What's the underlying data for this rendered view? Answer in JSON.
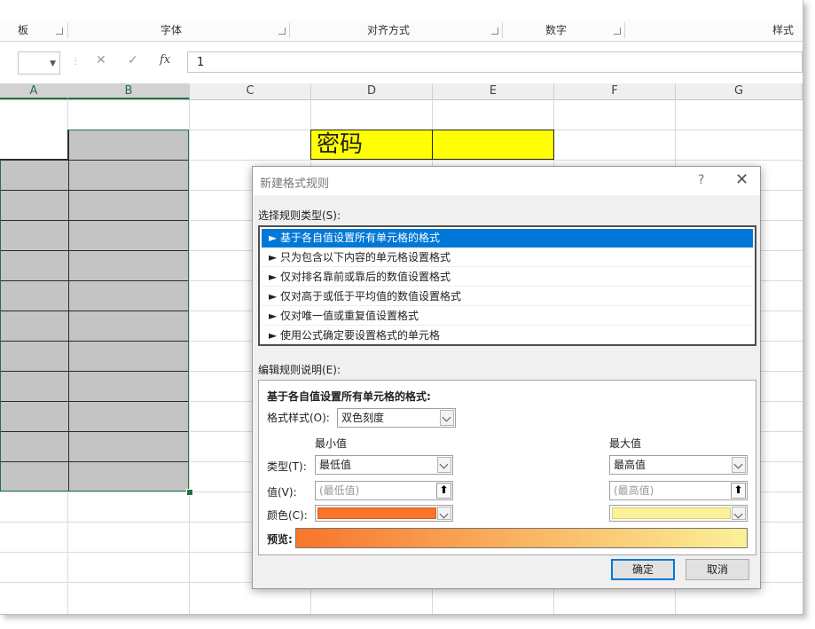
{
  "ribbon": {
    "groups": [
      "板",
      "字体",
      "对齐方式",
      "数字",
      "样式"
    ]
  },
  "formula_bar": {
    "name_box": "",
    "cancel": "✕",
    "enter": "✓",
    "fx": "fx",
    "value": "1"
  },
  "columns": [
    "A",
    "B",
    "C",
    "D",
    "E",
    "F",
    "G"
  ],
  "cells": {
    "D3": "密码"
  },
  "dialog": {
    "title": "新建格式规则",
    "help": "?",
    "close": "✕",
    "select_type_label": "选择规则类型(S):",
    "rule_types": [
      "► 基于各自值设置所有单元格的格式",
      "► 只为包含以下内容的单元格设置格式",
      "► 仅对排名靠前或靠后的数值设置格式",
      "► 仅对高于或低于平均值的数值设置格式",
      "► 仅对唯一值或重复值设置格式",
      "► 使用公式确定要设置格式的单元格"
    ],
    "selected_rule_index": 0,
    "edit_label": "编辑规则说明(E):",
    "desc_title": "基于各自值设置所有单元格的格式:",
    "format_style_label": "格式样式(O):",
    "format_style_value": "双色刻度",
    "min_label": "最小值",
    "max_label": "最大值",
    "type_label": "类型(T):",
    "value_label": "值(V):",
    "color_label": "颜色(C):",
    "min_type": "最低值",
    "max_type": "最高值",
    "min_value_placeholder": "(最低值)",
    "max_value_placeholder": "(最高值)",
    "min_color": "#f8752c",
    "max_color": "#fbf198",
    "preview_label": "预览:",
    "ok": "确定",
    "cancel": "取消"
  }
}
